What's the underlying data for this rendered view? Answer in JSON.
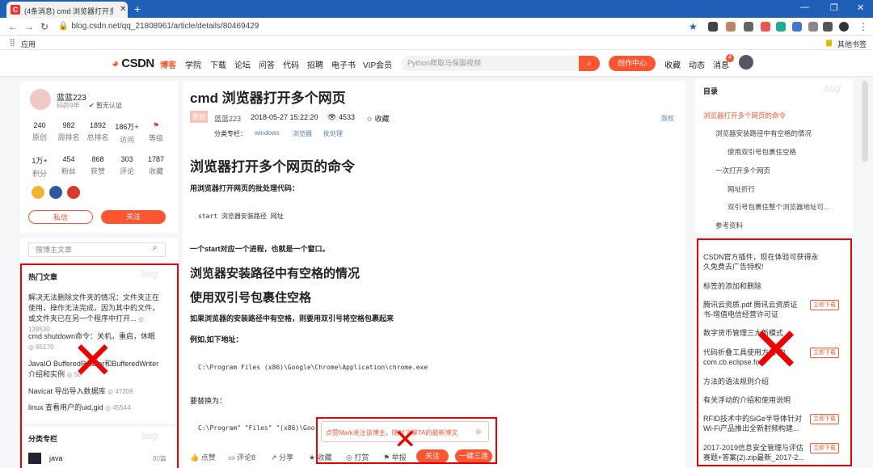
{
  "browser": {
    "tab_title": "(4条消息) cmd 浏览器打开多个网",
    "new_tab": "+",
    "url": "blog.csdn.net/qq_21808961/article/details/80469429",
    "bookmark_apps": "应用",
    "bookmark_other": "其他书签",
    "win_min": "—",
    "win_max": "❐",
    "win_close": "✕"
  },
  "topnav": {
    "logo": "CSDN",
    "items": [
      "博客",
      "学院",
      "下载",
      "论坛",
      "问答",
      "代码",
      "招聘",
      "电子书",
      "VIP会员"
    ],
    "active_item": "博客",
    "search_placeholder": "Python爬取马保国视频",
    "create_button": "创作中心",
    "right_items": [
      "收藏",
      "动态",
      "消息"
    ],
    "badge_count": "4"
  },
  "author": {
    "name": "蓝蓝223",
    "years": "码龄9年",
    "cert": "暂无认证",
    "stats_row1": [
      {
        "value": "240",
        "label": "原创"
      },
      {
        "value": "982",
        "label": "周排名"
      },
      {
        "value": "1892",
        "label": "总排名"
      },
      {
        "value": "186万+",
        "label": "访问"
      },
      {
        "value": "",
        "label": "等级"
      }
    ],
    "stats_row2": [
      {
        "value": "1万+",
        "label": "积分"
      },
      {
        "value": "454",
        "label": "粉丝"
      },
      {
        "value": "868",
        "label": "获赞"
      },
      {
        "value": "303",
        "label": "评论"
      },
      {
        "value": "1787",
        "label": "收藏"
      }
    ],
    "private_msg": "私信",
    "follow": "关注",
    "search_placeholder": "搜博主文章"
  },
  "hot": {
    "title": "热门文章",
    "items": [
      {
        "text": "解决无法删除文件夹的情况：文件夹正在使用，操作无法完成，因为其中的文件，或文件夹已在另一个程序中打开...",
        "views": "128530"
      },
      {
        "text": "cmd shutdown命令：关机，重启，休眠",
        "views": "65170"
      },
      {
        "text": "JavaIO BufferedReader和BufferedWriter介绍和实例",
        "views": "58"
      },
      {
        "text": "Navicat 导出导入数据库",
        "views": "47209"
      },
      {
        "text": "linux 查看用户的uid,gid",
        "views": "45544"
      }
    ]
  },
  "columns": {
    "title": "分类专栏",
    "items": [
      {
        "name": "java",
        "count": "80篇"
      }
    ]
  },
  "article": {
    "title": "cmd 浏览器打开多个网页",
    "tag": "原创",
    "author": "蓝蓝223",
    "date": "2018-05-27 15:22:20",
    "views": "4533",
    "fav": "收藏",
    "copyright": "版权",
    "category_label": "分类专栏：",
    "categories": [
      "windows",
      "浏览器",
      "批处理"
    ],
    "h1": "浏览器打开多个网页的命令",
    "p1": "用浏览器打开网页的批处理代码：",
    "code1": "start 浏览器安装路径 网址",
    "p2": "一个start对应一个进程，也就是一个窗口。",
    "h2a": "浏览器安装路径中有空格的情况",
    "h2b": "使用双引号包裹住空格",
    "p3": "如果浏览器的安装路径中有空格，则要用双引号将空格包裹起来",
    "p4": "例如,如下地址：",
    "code2": "C:\\Program Files (x86)\\Google\\Chrome\\Application\\chrome.exe",
    "p5": "要替换为：",
    "code3": "C:\\Program\" \"Files\" \"(x86)\\Goo"
  },
  "toolbar": {
    "like": "点赞",
    "comment": "评论8",
    "share": "分享",
    "fav": "收藏",
    "reward": "打赏",
    "report": "举报",
    "follow": "关注",
    "oneclick": "一键三连"
  },
  "popup": {
    "text": "点赞Mark关注该博主，随时了解TA的最新博文"
  },
  "toc": {
    "title": "目录",
    "items": [
      {
        "text": "浏览器打开多个网页的命令",
        "level": 1,
        "active": true
      },
      {
        "text": "浏览器安装路径中有空格的情况",
        "level": 2,
        "active": false
      },
      {
        "text": "使用双引号包裹住空格",
        "level": 3,
        "active": false
      },
      {
        "text": "一次打开多个网页",
        "level": 2,
        "active": false
      },
      {
        "text": "网址折行",
        "level": 3,
        "active": false
      },
      {
        "text": "双引号包裹住整个浏览器地址可...",
        "level": 3,
        "active": false
      },
      {
        "text": "参考资料",
        "level": 2,
        "active": false
      }
    ]
  },
  "ads": {
    "download_label": "立即下载",
    "items": [
      {
        "text": "CSDN官方插件，现在体验可获得永久免费去广告特权!",
        "dl": false
      },
      {
        "text": "标签的添加和删除",
        "dl": false
      },
      {
        "text": "腾讯云资质.pdf 腾讯云资质证书-增值电信经营许可证",
        "dl": true
      },
      {
        "text": "数字货币管理三大新模式",
        "dl": false
      },
      {
        "text": "代码折叠工具使用方法 内com.cb.eclipse.fo...",
        "dl": true
      },
      {
        "text": "方法的语法规则介绍",
        "dl": false
      },
      {
        "text": "有关浮动的介绍和使用说明",
        "dl": false
      },
      {
        "text": "RFID技术中的SiGe半导体针对Wi-Fi产品推出全新射频构建...",
        "dl": true
      },
      {
        "text": "2017-2019信息安全管理与评估赛题+答案(2).zip最新_2017-2...",
        "dl": true
      }
    ]
  },
  "watermark": "bug",
  "colors": {
    "accent": "#fc5531",
    "annotation": "#e00000",
    "chrome_blue": "#1f5fb8"
  }
}
